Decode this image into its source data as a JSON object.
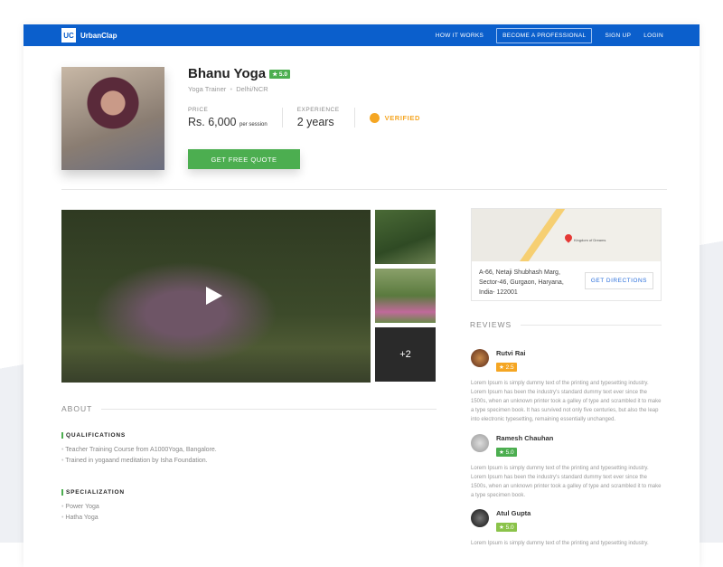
{
  "nav": {
    "logo_mark": "UC",
    "brand": "UrbanClap",
    "links": [
      "HOW IT WORKS",
      "BECOME A PROFESSIONAL",
      "SIGN UP",
      "LOGIN"
    ]
  },
  "profile": {
    "name": "Bhanu Yoga",
    "rating": "★ 5.0",
    "title": "Yoga Trainer",
    "separator": "•",
    "location": "Delhi/NCR",
    "price_label": "PRICE",
    "price": "Rs. 6,000",
    "price_unit": "per session",
    "experience_label": "EXPERIENCE",
    "experience": "2 years",
    "verified": "VERIFIED",
    "quote_button": "GET FREE QUOTE"
  },
  "gallery": {
    "more": "+2"
  },
  "about": {
    "heading": "ABOUT",
    "qualifications_title": "QUALIFICATIONS",
    "qualifications": [
      "Teacher Training Course from A1000Yoga,  Bangalore.",
      "Trained in yogaand meditation by Isha Foundation."
    ],
    "specialization_title": "SPECIALIZATION",
    "specialization": [
      "Power Yoga",
      "Hatha Yoga"
    ]
  },
  "map": {
    "place": "Kingdom of Dreams",
    "address": "A-66, Netaji Shubhash Marg, Sector-46, Gurgaon, Haryana, India- 122001",
    "directions_button": "GET DIRECTIONS"
  },
  "reviews": {
    "heading": "REVIEWS",
    "items": [
      {
        "name": "Rutvi Rai",
        "rating": "★ 2.5",
        "color": "#f5a623",
        "text": "Lorem Ipsum is simply dummy text of the printing and typesetting industry. Lorem Ipsum has been the industry's standard dummy text ever since the 1500s, when an unknown printer took a galley of type and scrambled it to make a type specimen book. It has survived not only five centuries, but also the leap into electronic typesetting, remaining essentially unchanged."
      },
      {
        "name": "Ramesh Chauhan",
        "rating": "★ 5.0",
        "color": "#4cae50",
        "text": "Lorem Ipsum is simply dummy text of the printing and typesetting industry. Lorem Ipsum has been the industry's standard dummy text ever since the 1500s, when an unknown printer took a galley of type and scrambled it to make a type specimen book."
      },
      {
        "name": "Atul Gupta",
        "rating": "★ 5.0",
        "color": "#8bc34a",
        "text": "Lorem Ipsum is simply dummy text of the printing and typesetting industry."
      }
    ]
  }
}
